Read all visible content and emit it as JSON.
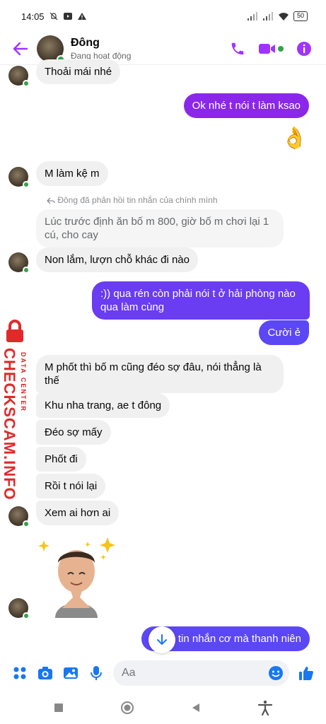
{
  "status_bar": {
    "time": "14:05",
    "battery": "50"
  },
  "header": {
    "name": "Đông",
    "status": "Đang hoạt động"
  },
  "reply_label": "Đông đã phản hồi tin nhắn của chính mình",
  "messages": [
    {
      "text": "Thoải mái nhé"
    },
    {
      "text": "Ok nhé t nói t làm ksao"
    },
    {
      "text": "👌"
    },
    {
      "text": "M làm kệ m"
    },
    {
      "text": "Lúc trước định ăn bố m 800, giờ bố m chơi lại 1 cú, cho cay"
    },
    {
      "text": "Non lắm, lượn chỗ khác đi nào"
    },
    {
      "text": ":)) qua rén còn phải nói t ở hải phòng nào qua làm cùng"
    },
    {
      "text": "Cười ẻ"
    },
    {
      "text": "M phốt thì bố m cũng đéo sợ đâu, nói thẳng là thế"
    },
    {
      "text": "Khu nha trang, ae t đông"
    },
    {
      "text": "Đéo sợ mấy"
    },
    {
      "text": "Phốt đi"
    },
    {
      "text": "Rồi t nói lại"
    },
    {
      "text": "Xem ai hơn ai"
    },
    {
      "text": "tin nhắn cơ mà thanh niên"
    }
  ],
  "watermark": {
    "main": "CHECKSCAM.INFO",
    "sub": "DATA CENTER"
  },
  "composer": {
    "placeholder": "Aa"
  },
  "colors": {
    "accent": "#a033ff",
    "online": "#31a24c",
    "watermark": "#e02a2a"
  }
}
